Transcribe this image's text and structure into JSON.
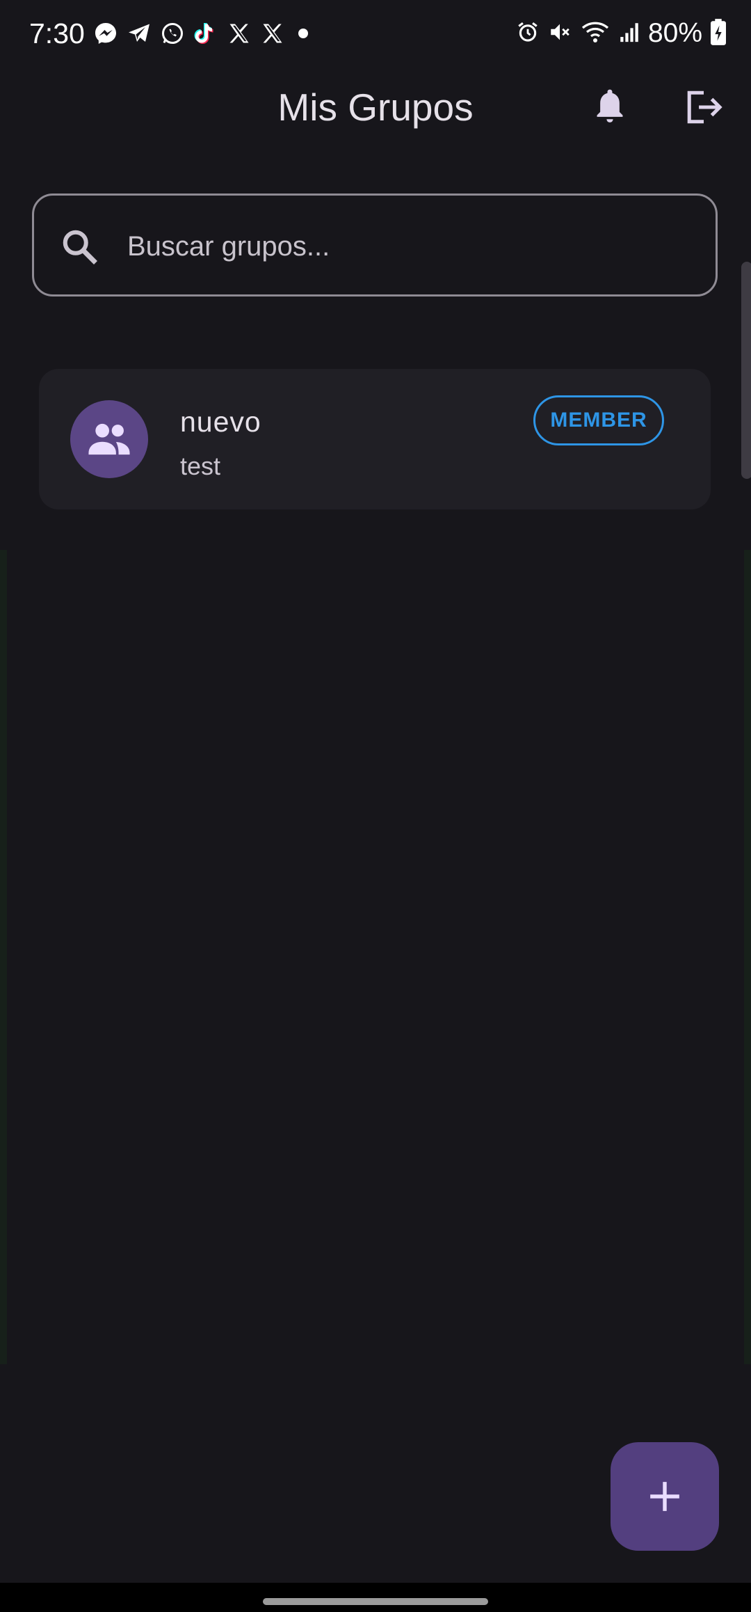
{
  "status_bar": {
    "time": "7:30",
    "battery": "80%",
    "notification_icons": [
      "messenger-icon",
      "telegram-icon",
      "whatsapp-icon",
      "tiktok-icon",
      "x-icon",
      "x-icon",
      "dot-icon"
    ],
    "system_icons": [
      "alarm-icon",
      "mute-icon",
      "wifi-icon",
      "signal-icon",
      "battery-icon"
    ]
  },
  "app_bar": {
    "title": "Mis Grupos",
    "actions": [
      "bell-icon",
      "logout-icon"
    ]
  },
  "search": {
    "placeholder": "Buscar grupos...",
    "value": ""
  },
  "groups": [
    {
      "name": "nuevo",
      "description": "test",
      "role": "MEMBER",
      "icon": "group-icon"
    }
  ],
  "fab": {
    "icon": "plus-icon"
  },
  "colors": {
    "background": "#17161b",
    "card": "#201f25",
    "avatar": "#5b4686",
    "badge": "#2e95e6",
    "fab": "#533f7f"
  }
}
